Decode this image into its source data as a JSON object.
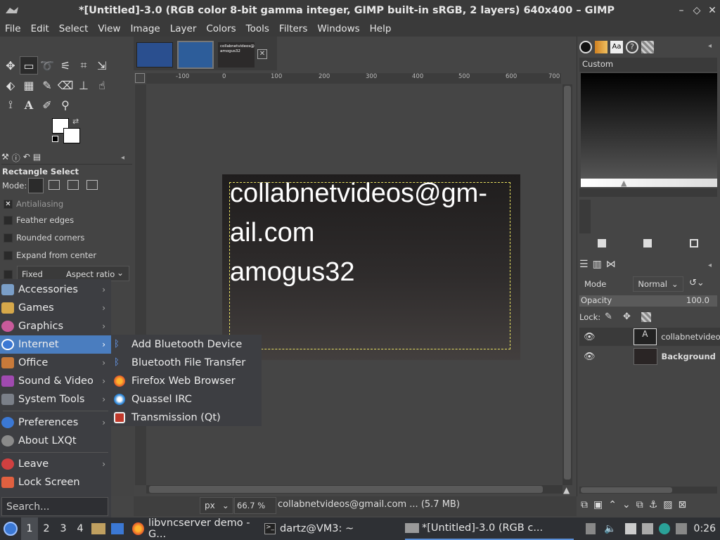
{
  "window": {
    "title": "*[Untitled]-3.0 (RGB color 8-bit gamma integer, GIMP built-in sRGB, 2 layers) 640x400 – GIMP"
  },
  "menubar": [
    "File",
    "Edit",
    "Select",
    "View",
    "Image",
    "Layer",
    "Colors",
    "Tools",
    "Filters",
    "Windows",
    "Help"
  ],
  "image_tabs": {
    "tab3_text": "collabnetvideos@gmail.com amogus32"
  },
  "tool_options": {
    "title": "Rectangle Select",
    "mode_label": "Mode:",
    "antialiasing": "Antialiasing",
    "feather": "Feather edges",
    "rounded": "Rounded corners",
    "expand": "Expand from center",
    "fixed": "Fixed",
    "aspect": "Aspect ratio"
  },
  "canvas": {
    "line1": "collabnetvideos@gm-",
    "line2": "ail.com",
    "line3": "amogus32",
    "ruler_labels": [
      "-100",
      "0",
      "100",
      "200",
      "300",
      "400",
      "500",
      "600",
      "700"
    ]
  },
  "statusbar": {
    "unit": "px",
    "zoom": "66.7 %",
    "message": "collabnetvideos@gmail.com ... (5.7 MB)"
  },
  "gradients": {
    "label": "Custom"
  },
  "layers": {
    "mode_label": "Mode",
    "mode_value": "Normal",
    "opacity_label": "Opacity",
    "opacity_value": "100.0",
    "lock_label": "Lock:",
    "items": [
      {
        "name": "collabnetvideo"
      },
      {
        "name": "Background"
      }
    ]
  },
  "app_menu": {
    "items": [
      {
        "label": "Accessories",
        "has_sub": true,
        "color": "#7a9ec8"
      },
      {
        "label": "Games",
        "has_sub": true,
        "color": "#d6a84a"
      },
      {
        "label": "Graphics",
        "has_sub": true,
        "color": "#c85a9a"
      },
      {
        "label": "Internet",
        "has_sub": true,
        "color": "#3b78d4"
      },
      {
        "label": "Office",
        "has_sub": true,
        "color": "#c87a3a"
      },
      {
        "label": "Sound & Video",
        "has_sub": true,
        "color": "#a04ab0"
      },
      {
        "label": "System Tools",
        "has_sub": true,
        "color": "#7a7f88"
      },
      {
        "label": "Preferences",
        "has_sub": true,
        "color": "#3b78d4"
      },
      {
        "label": "About LXQt",
        "has_sub": false,
        "color": "#8a8a8a"
      },
      {
        "label": "Leave",
        "has_sub": true,
        "color": "#d04040"
      },
      {
        "label": "Lock Screen",
        "has_sub": false,
        "color": "#e06040"
      }
    ],
    "search_placeholder": "Search..."
  },
  "internet_submenu": [
    {
      "label": "Add Bluetooth Device",
      "icon": "bluetooth-icon"
    },
    {
      "label": "Bluetooth File Transfer",
      "icon": "bluetooth-icon"
    },
    {
      "label": "Firefox Web Browser",
      "icon": "firefox-icon"
    },
    {
      "label": "Quassel IRC",
      "icon": "quassel-icon"
    },
    {
      "label": "Transmission (Qt)",
      "icon": "transmission-icon"
    }
  ],
  "taskbar": {
    "desktops": [
      "1",
      "2",
      "3",
      "4"
    ],
    "tasks": [
      {
        "label": "libvncserver demo - G..."
      },
      {
        "label": "dartz@VM3: ~"
      },
      {
        "label": "*[Untitled]-3.0 (RGB c..."
      }
    ],
    "clock": "0:26"
  }
}
